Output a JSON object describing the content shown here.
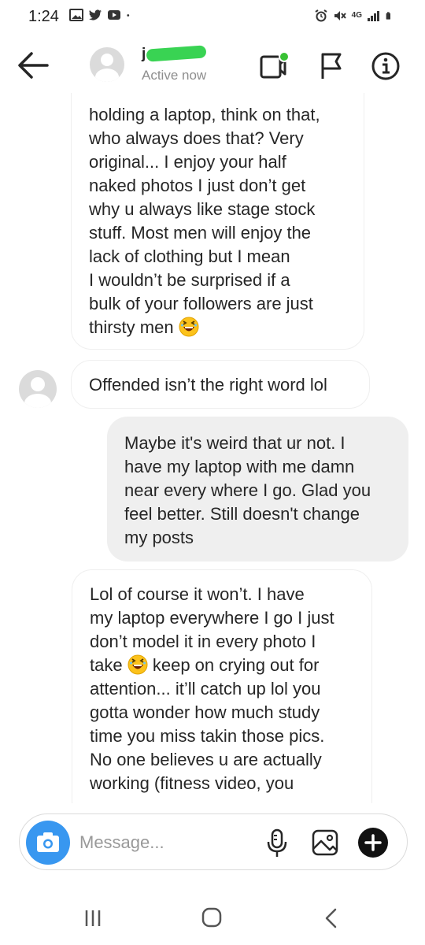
{
  "status_bar": {
    "time": "1:24",
    "left_icons": [
      "image-icon",
      "twitter-icon",
      "youtube-icon",
      "dot-icon"
    ],
    "right_icons": [
      "alarm-icon",
      "mute-icon",
      "network-4g-icon",
      "signal-icon",
      "battery-icon"
    ],
    "network_label": "4G"
  },
  "header": {
    "username": "j",
    "active_status": "Active now",
    "redaction_color": "#39d353"
  },
  "messages": [
    {
      "side": "incoming",
      "lines": [
        "holding a laptop, think on that,",
        "who always does that? Very",
        "original... I enjoy your half",
        "naked photos I just don’t get",
        "why u always like stage stock",
        "stuff. Most men will enjoy the",
        "lack of clothing but I mean",
        "I wouldn’t be surprised if a",
        "bulk of your followers are just",
        "thirsty men"
      ],
      "emoji": "laughing-face-icon"
    },
    {
      "side": "incoming",
      "text": "Offended isn’t the right word lol"
    },
    {
      "side": "outgoing",
      "lines": [
        "Maybe it's weird that ur not. I",
        "have my laptop with me damn",
        "near every where I go. Glad you",
        "feel better. Still doesn't change",
        "my posts"
      ]
    },
    {
      "side": "incoming",
      "lines": [
        "Lol of course it won’t. I have",
        "my laptop everywhere I go I just",
        "don’t model it in every photo I",
        "take",
        "keep on crying out for",
        "attention... it’ll catch up lol you",
        "gotta wonder how much study",
        "time you miss takin those pics.",
        "No one believes u are actually",
        "working (fitness video, you"
      ],
      "emoji": "laughing-face-icon"
    }
  ],
  "composer": {
    "placeholder": "Message...",
    "accent_color": "#3897f0"
  },
  "navbar": {
    "items": [
      "recents-icon",
      "home-icon",
      "back-chevron-icon"
    ]
  }
}
